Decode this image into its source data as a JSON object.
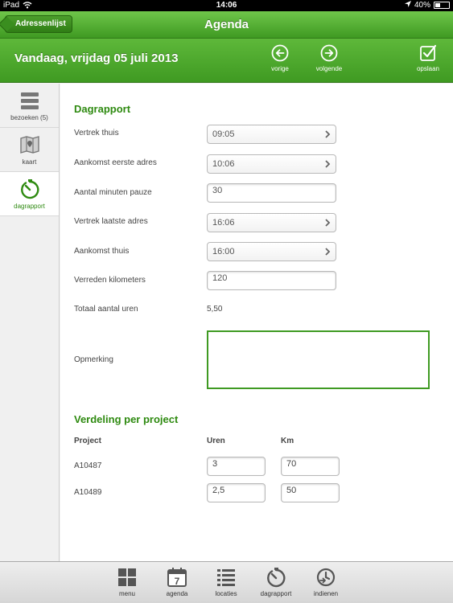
{
  "status": {
    "device": "iPad",
    "time": "14:06",
    "battery": "40%",
    "battery_level": 0.4
  },
  "nav": {
    "back_label": "Adressenlijst",
    "title": "Agenda"
  },
  "toolbar": {
    "date": "Vandaag, vrijdag 05 juli 2013",
    "prev_label": "vorige",
    "next_label": "volgende",
    "save_label": "opslaan"
  },
  "sidebar": {
    "items": [
      {
        "label": "bezoeken (5)",
        "icon": "list-icon"
      },
      {
        "label": "kaart",
        "icon": "map-icon"
      },
      {
        "label": "dagrapport",
        "icon": "timer-icon"
      }
    ]
  },
  "report": {
    "title": "Dagrapport",
    "fields": [
      {
        "label": "Vertrek thuis",
        "value": "09:05"
      },
      {
        "label": "Aankomst eerste adres",
        "value": "10:06"
      },
      {
        "label": "Aantal minuten pauze",
        "value": "30"
      },
      {
        "label": "Vertrek laatste adres",
        "value": "16:06"
      },
      {
        "label": "Aankomst thuis",
        "value": "16:00"
      },
      {
        "label": "Verreden kilometers",
        "value": "120"
      },
      {
        "label": "Totaal aantal uren",
        "value": "5,50"
      },
      {
        "label": "Opmerking",
        "value": ""
      }
    ]
  },
  "projects": {
    "title": "Verdeling per project",
    "headers": {
      "project": "Project",
      "hours": "Uren",
      "km": "Km"
    },
    "rows": [
      {
        "project": "A10487",
        "hours": "3",
        "km": "70"
      },
      {
        "project": "A10489",
        "hours": "2,5",
        "km": "50"
      }
    ]
  },
  "tabbar": {
    "items": [
      {
        "label": "menu",
        "icon": "grid-icon"
      },
      {
        "label": "agenda",
        "icon": "calendar-icon",
        "calendar_day": "7"
      },
      {
        "label": "locaties",
        "icon": "list-icon"
      },
      {
        "label": "dagrapport",
        "icon": "timer-icon"
      },
      {
        "label": "indienen",
        "icon": "submit-icon"
      }
    ]
  },
  "colors": {
    "accent": "#3f9a22",
    "accent_text": "#2e8a10"
  }
}
